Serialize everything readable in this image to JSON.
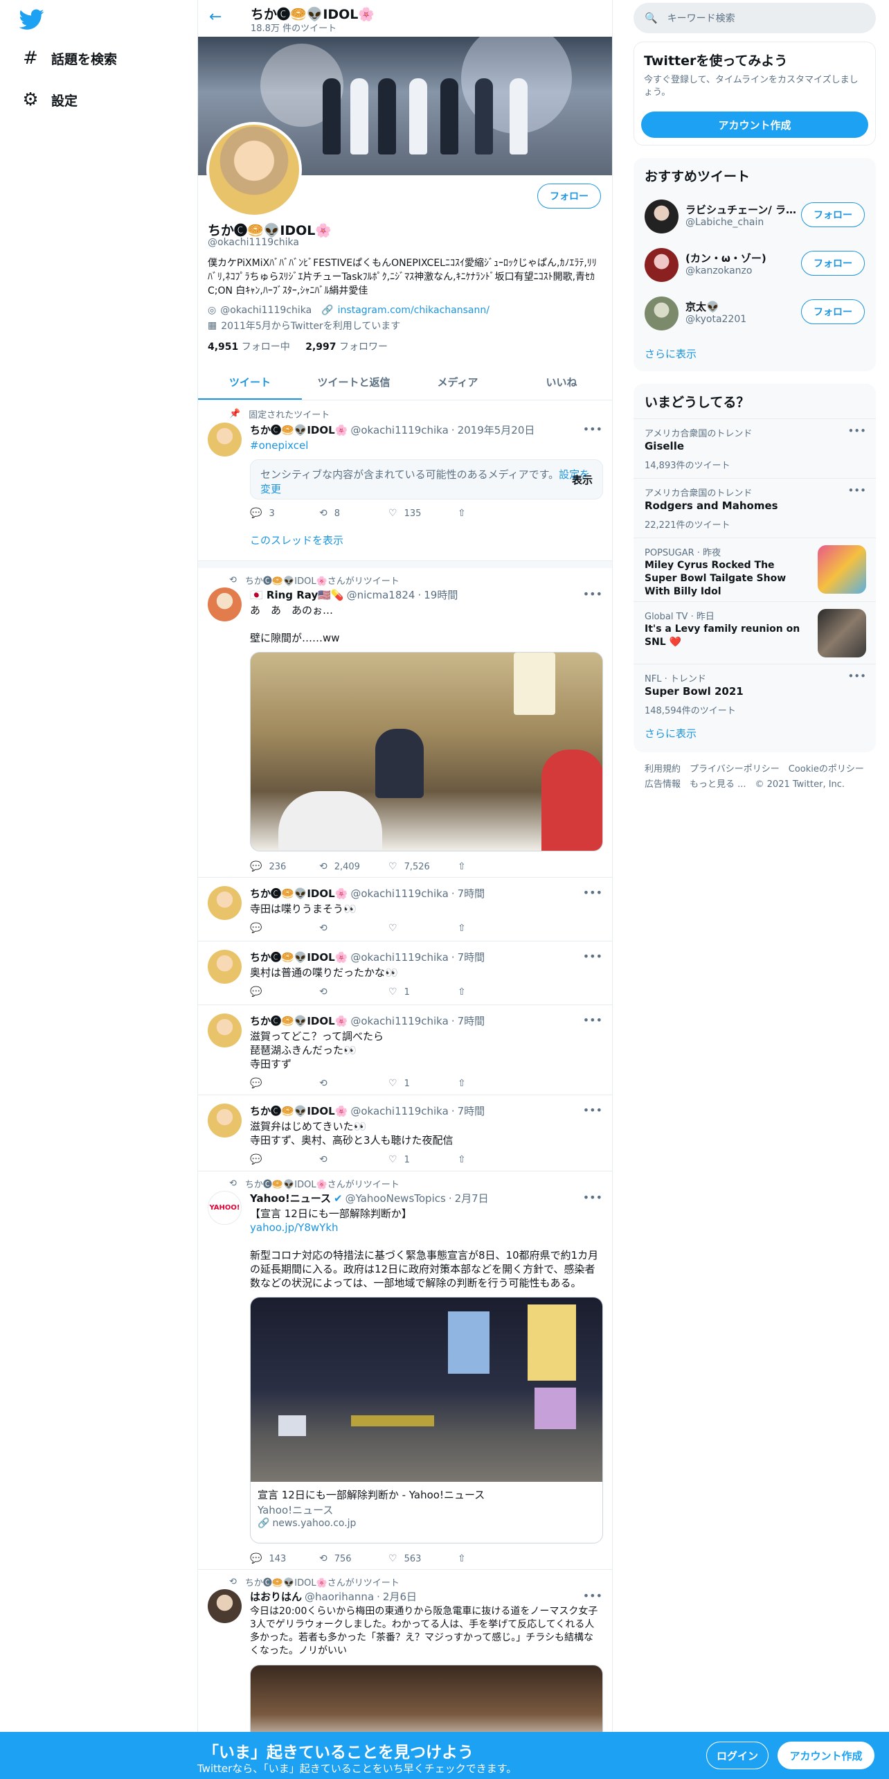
{
  "nav": {
    "explore_label": "話題を検索",
    "settings_label": "設定"
  },
  "header": {
    "name": "ちか🅒🥯👽IDOL🌸",
    "tweet_count": "18.8万 件のツイート"
  },
  "profile": {
    "name": "ちか🅒🥯👽IDOL🌸",
    "handle": "@okachi1119chika",
    "follow_label": "フォロー",
    "bio": "僕カケPiXMiXﾊﾞﾊﾞﾊﾞﾝﾋﾞFESTIVEぱくもんONEPIXCELﾆｺｽｲ愛縮ｼﾞｭｰﾛｯｸじゃぱん,ｶﾉｴﾗﾃ,ﾘﾘﾊﾞﾘ,ﾈｺﾌﾟﾗちゅらｽﾘｼﾞｴ片チューTaskﾌﾙﾎﾟｸ,ﾆｼﾞﾏｽ神激なん,ｷﾆｹﾅﾗﾝﾄﾞ坂口有望ﾆｺｽﾄ開歌,青ｾｶC;ON 白ｷｬﾝ,ﾊｰﾌﾞｽﾀｰ,ｼｬﾆﾊﾞﾙ絹井愛佳",
    "location": "@okachi1119chika",
    "link": "instagram.com/chikachansann/",
    "joined": "2011年5月からTwitterを利用しています",
    "following_count": "4,951",
    "following_label": "フォロー中",
    "followers_count": "2,997",
    "followers_label": "フォロワー"
  },
  "tabs": [
    "ツイート",
    "ツイートと返信",
    "メディア",
    "いいね"
  ],
  "tweets": [
    {
      "pinned_label": "固定されたツイート",
      "name": "ちか🅒🥯👽IDOL🌸",
      "handle": "@okachi1119chika",
      "time": "2019年5月20日",
      "hashtag": "#onepixcel",
      "sensitive_text": "センシティブな内容が含まれている可能性のあるメディアです。",
      "sensitive_link": "設定を変更",
      "sensitive_show": "表示",
      "replies": "3",
      "retweets": "8",
      "likes": "135",
      "thread_link": "このスレッドを表示"
    },
    {
      "retweet_label": "ちか🅒🥯👽IDOL🌸さんがリツイート",
      "name": "🇯🇵 Ring Ray🇺🇸💊",
      "handle": "@nicma1824",
      "time": "19時間",
      "text1": "あ　あ　あのぉ…",
      "text2": "壁に隙間が……ww",
      "replies": "236",
      "retweets": "2,409",
      "likes": "7,526"
    },
    {
      "name": "ちか🅒🥯👽IDOL🌸",
      "handle": "@okachi1119chika",
      "time": "7時間",
      "text": "寺田は喋りうまそう👀",
      "replies": "",
      "retweets": "",
      "likes": ""
    },
    {
      "name": "ちか🅒🥯👽IDOL🌸",
      "handle": "@okachi1119chika",
      "time": "7時間",
      "text": "奥村は普通の喋りだったかな👀",
      "replies": "",
      "retweets": "",
      "likes": "1"
    },
    {
      "name": "ちか🅒🥯👽IDOL🌸",
      "handle": "@okachi1119chika",
      "time": "7時間",
      "text1": "滋賀ってどこ？って調べたら",
      "text2": "琵琶湖ふきんだった👀",
      "text3": "寺田すず",
      "replies": "",
      "retweets": "",
      "likes": "1"
    },
    {
      "name": "ちか🅒🥯👽IDOL🌸",
      "handle": "@okachi1119chika",
      "time": "7時間",
      "text1": "滋賀弁はじめてきいた👀",
      "text2": "寺田すず、奥村、高砂と3人も聴けた夜配信",
      "replies": "",
      "retweets": "",
      "likes": "1"
    },
    {
      "retweet_label": "ちか🅒🥯👽IDOL🌸さんがリツイート",
      "name": "Yahoo!ニュース",
      "handle": "@YahooNewsTopics",
      "time": "2月7日",
      "text1": "【宣言 12日にも一部解除判断か】",
      "link": "yahoo.jp/Y8wYkh",
      "text2": "新型コロナ対応の特措法に基づく緊急事態宣言が8日、10都府県で約1カ月の延長期間に入る。政府は12日に政府対策本部などを開く方針で、感染者数などの状況によっては、一部地域で解除の判断を行う可能性もある。",
      "card_title": "宣言 12日にも一部解除判断か - Yahoo!ニュース",
      "card_source": "Yahoo!ニュース",
      "card_domain": "news.yahoo.co.jp",
      "replies": "143",
      "retweets": "756",
      "likes": "563"
    },
    {
      "retweet_label": "ちか🅒🥯👽IDOL🌸さんがリツイート",
      "name": "はおりはん",
      "handle": "@haorihanna",
      "time": "2月6日",
      "text": "今日は20:00くらいから梅田の東通りから阪急電車に抜ける道をノーマスク女子3人でゲリラウォークしました。わかってる人は、手を挙げて反応してくれる人多かった。若者も多かった「茶番？え？マジっすかって感じ。」チラシも結構なくなった。ノリがいい"
    }
  ],
  "sidebar": {
    "search_placeholder": "キーワード検索",
    "signup": {
      "title": "Twitterを使ってみよう",
      "text": "今すぐ登録して、タイムラインをカスタマイズしましょう。",
      "button": "アカウント作成"
    },
    "suggest": {
      "title": "おすすめツイート",
      "follow_label": "フォロー",
      "users": [
        {
          "name": "ラビシュチェーン/ ラ…",
          "handle": "@Labiche_chain"
        },
        {
          "name": "(カン・ω・ゾー)",
          "handle": "@kanzokanzo"
        },
        {
          "name": "京太👽",
          "handle": "@kyota2201"
        }
      ],
      "show_more": "さらに表示"
    },
    "trends": {
      "title": "いまどうしてる？",
      "items": [
        {
          "context": "アメリカ合衆国のトレンド",
          "title": "Giselle",
          "count": "14,893件のツイート"
        },
        {
          "context": "アメリカ合衆国のトレンド",
          "title": "Rodgers and Mahomes",
          "count": "22,221件のツイート"
        },
        {
          "context": "POPSUGAR · 昨夜",
          "title": "Miley Cyrus Rocked The Super Bowl Tailgate Show With Billy Idol",
          "count": ""
        },
        {
          "context": "Global TV · 昨日",
          "title": "It's a Levy family reunion on SNL ❤️",
          "count": ""
        },
        {
          "context": "NFL · トレンド",
          "title": "Super Bowl 2021",
          "count": "148,594件のツイート"
        }
      ],
      "show_more": "さらに表示"
    },
    "footer": {
      "line1": "利用規約　プライバシーポリシー　Cookieのポリシー",
      "line2": "広告情報　もっと見る ...　© 2021 Twitter, Inc."
    }
  },
  "bottom": {
    "title": "「いま」起きていることを見つけよう",
    "subtitle": "Twitterなら、「いま」起きていることをいち早くチェックできます。",
    "login": "ログイン",
    "signup": "アカウント作成"
  }
}
